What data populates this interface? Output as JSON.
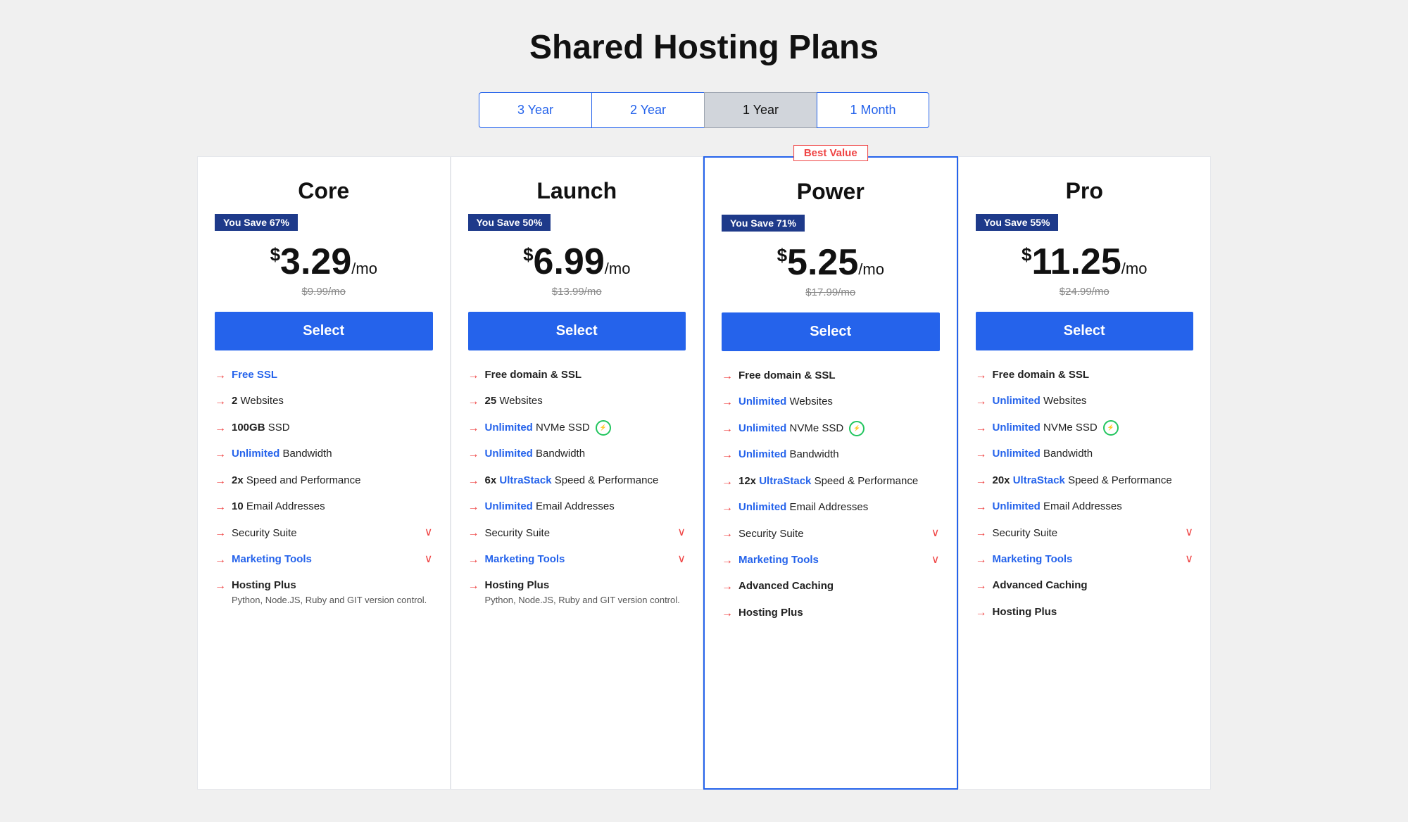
{
  "page": {
    "title": "Shared Hosting Plans"
  },
  "billing": {
    "tabs": [
      {
        "label": "3 Year",
        "active": false
      },
      {
        "label": "2 Year",
        "active": false
      },
      {
        "label": "1 Year",
        "active": true
      },
      {
        "label": "1 Month",
        "active": false
      }
    ]
  },
  "plans": [
    {
      "name": "Core",
      "savings": "You Save 67%",
      "price": "3.29",
      "price_period": "/mo",
      "original_price": "$9.99/mo",
      "select_label": "Select",
      "featured": false,
      "best_value": false,
      "features": [
        {
          "highlight": "Free SSL",
          "rest": ""
        },
        {
          "bold": "2",
          "rest": " Websites"
        },
        {
          "bold": "100GB",
          "rest": " SSD"
        },
        {
          "highlight": "Unlimited",
          "rest": " Bandwidth"
        },
        {
          "bold": "2x",
          "rest": " Speed and Performance"
        },
        {
          "bold": "10",
          "rest": " Email Addresses"
        },
        {
          "expandable": true,
          "text": "Security Suite"
        },
        {
          "expandable": true,
          "highlight": true,
          "text": "Marketing Tools"
        },
        {
          "bold": "Hosting Plus",
          "rest": "",
          "subtext": "Python, Node.JS, Ruby and GIT version control."
        }
      ]
    },
    {
      "name": "Launch",
      "savings": "You Save 50%",
      "price": "6.99",
      "price_period": "/mo",
      "original_price": "$13.99/mo",
      "select_label": "Select",
      "featured": false,
      "best_value": false,
      "features": [
        {
          "bold": "Free domain & SSL",
          "rest": ""
        },
        {
          "bold": "25",
          "rest": " Websites"
        },
        {
          "highlight": "Unlimited",
          "rest": " NVMe SSD",
          "speed": true
        },
        {
          "highlight": "Unlimited",
          "rest": " Bandwidth"
        },
        {
          "bold": "6x",
          "highlight_text": " UltraStack",
          "rest": " Speed & Performance"
        },
        {
          "highlight": "Unlimited",
          "rest": " Email Addresses"
        },
        {
          "expandable": true,
          "text": "Security Suite"
        },
        {
          "expandable": true,
          "highlight": true,
          "text": "Marketing Tools"
        },
        {
          "bold": "Hosting Plus",
          "rest": "",
          "subtext": "Python, Node.JS, Ruby and GIT version control."
        }
      ]
    },
    {
      "name": "Power",
      "savings": "You Save 71%",
      "price": "5.25",
      "price_period": "/mo",
      "original_price": "$17.99/mo",
      "select_label": "Select",
      "featured": true,
      "best_value": true,
      "best_value_label": "Best Value",
      "features": [
        {
          "bold": "Free domain & SSL",
          "rest": ""
        },
        {
          "highlight": "Unlimited",
          "rest": " Websites"
        },
        {
          "highlight": "Unlimited",
          "rest": " NVMe SSD",
          "speed": true
        },
        {
          "highlight": "Unlimited",
          "rest": " Bandwidth"
        },
        {
          "bold": "12x",
          "highlight_text": " UltraStack",
          "rest": " Speed & Performance"
        },
        {
          "highlight": "Unlimited",
          "rest": " Email Addresses"
        },
        {
          "expandable": true,
          "text": "Security Suite"
        },
        {
          "expandable": true,
          "highlight": true,
          "text": "Marketing Tools"
        },
        {
          "bold": "Advanced Caching",
          "rest": ""
        },
        {
          "bold": "Hosting Plus",
          "rest": ""
        }
      ]
    },
    {
      "name": "Pro",
      "savings": "You Save 55%",
      "price": "11.25",
      "price_period": "/mo",
      "original_price": "$24.99/mo",
      "select_label": "Select",
      "featured": false,
      "best_value": false,
      "features": [
        {
          "bold": "Free domain & SSL",
          "rest": ""
        },
        {
          "highlight": "Unlimited",
          "rest": " Websites"
        },
        {
          "highlight": "Unlimited",
          "rest": " NVMe SSD",
          "speed": true
        },
        {
          "highlight": "Unlimited",
          "rest": " Bandwidth"
        },
        {
          "bold": "20x",
          "highlight_text": " UltraStack",
          "rest": " Speed & Performance"
        },
        {
          "highlight": "Unlimited",
          "rest": " Email Addresses"
        },
        {
          "expandable": true,
          "text": "Security Suite"
        },
        {
          "expandable": true,
          "highlight": true,
          "text": "Marketing Tools"
        },
        {
          "bold": "Advanced Caching",
          "rest": ""
        },
        {
          "bold": "Hosting Plus",
          "rest": ""
        }
      ]
    }
  ]
}
